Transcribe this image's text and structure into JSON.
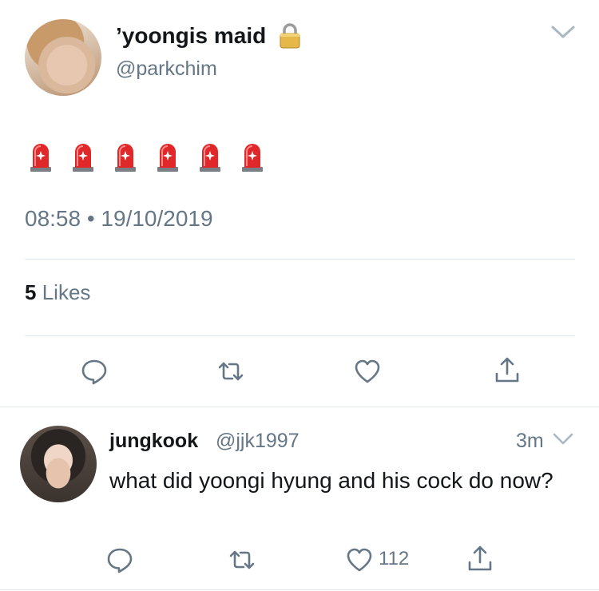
{
  "tweet": {
    "display_name": "’yoongis maid",
    "handle": "@parkchim",
    "lock_icon": "lock-icon",
    "body_emoji": [
      "🚨",
      "🚨",
      "🚨",
      "🚨",
      "🚨",
      "🚨"
    ],
    "timestamp": "08:58 • 19/10/2019",
    "likes_count": "5",
    "likes_label": "Likes",
    "actions": [
      "reply-icon",
      "retweet-icon",
      "like-icon",
      "share-icon"
    ]
  },
  "reply": {
    "display_name": "jungkook",
    "handle": "@jjk1997",
    "time": "3m",
    "text": "what did yoongi hyung and his cock do now?",
    "like_count": "112",
    "actions": [
      "reply-icon",
      "retweet-icon",
      "like-icon",
      "share-icon"
    ]
  },
  "colors": {
    "text_primary": "#14171a",
    "text_secondary": "#657786",
    "divider": "#e1e8ed"
  }
}
